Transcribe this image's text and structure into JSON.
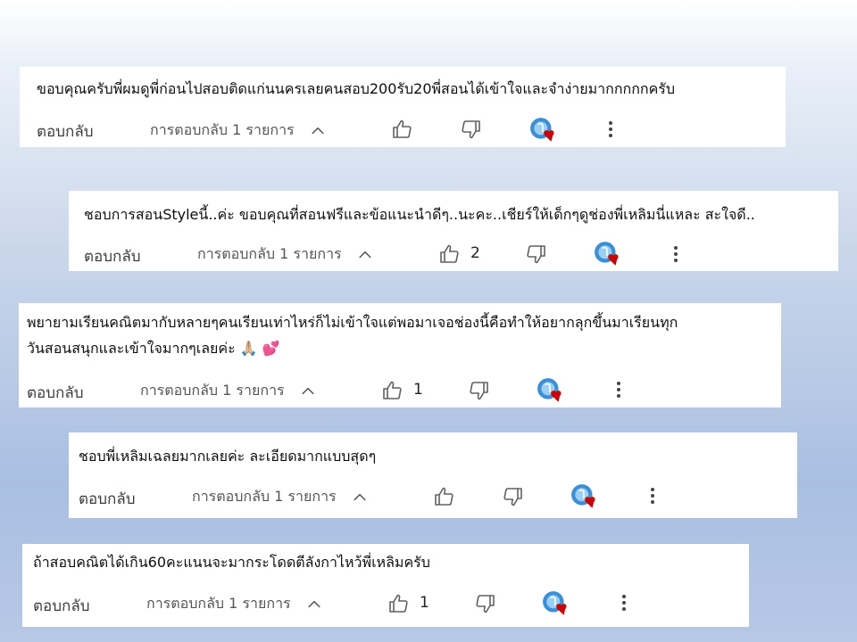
{
  "comments": [
    {
      "text": "ขอบคุณครับพี่ผมดูพี่ก่อนไปสอบติดแก่นนครเลยคนสอบ200รับ20พี่สอนได้เข้าใจและจำง่ายมากกกกกครับ",
      "reply_label": "ตอบกลับ",
      "replies_label": "การตอบกลับ 1 รายการ",
      "likes": ""
    },
    {
      "text": "ชอบการสอนStyleนี้..ค่ะ ขอบคุณที่สอนฟรีและข้อแนะนำดีๆ..นะคะ..เชียร์ให้เด็กๆดูช่องพี่เหลิมนี่แหละ สะใจดี..",
      "reply_label": "ตอบกลับ",
      "replies_label": "การตอบกลับ 1 รายการ",
      "likes": "2"
    },
    {
      "text_line1": "พยายามเรียนคณิตมากับหลายๆคนเรียนเท่าไหร่ก็ไม่เข้าใจแต่พอมาเจอช่องนี้คือทำให้อยากลุกขึ้นมาเรียนทุก",
      "text_line2": "วันสอนสนุกและเข้าใจมากๆเลยค่ะ",
      "emoji_pray": "🙏🏼",
      "emoji_hearts": "💕",
      "reply_label": "ตอบกลับ",
      "replies_label": "การตอบกลับ 1 รายการ",
      "likes": "1"
    },
    {
      "text": "ชอบพี่เหลิมเฉลยมากเลยค่ะ ละเอียดมากแบบสุดๆ",
      "reply_label": "ตอบกลับ",
      "replies_label": "การตอบกลับ 1 รายการ",
      "likes": ""
    },
    {
      "text": "ถ้าสอบคณิตได้เกิน60คะแนนจะมากระโดดตีลังกาไหว้พี่เหลิมครับ",
      "reply_label": "ตอบกลับ",
      "replies_label": "การตอบกลับ 1 รายการ",
      "likes": "1"
    }
  ],
  "icons": {
    "like": "thumbs-up-icon",
    "dislike": "thumbs-down-icon",
    "creator_heart": "creator-heart-icon",
    "more": "more-vert-icon",
    "chevron": "chevron-up-icon"
  },
  "colors": {
    "heart": "#cc0000",
    "avatar": "#3b8fd6"
  }
}
